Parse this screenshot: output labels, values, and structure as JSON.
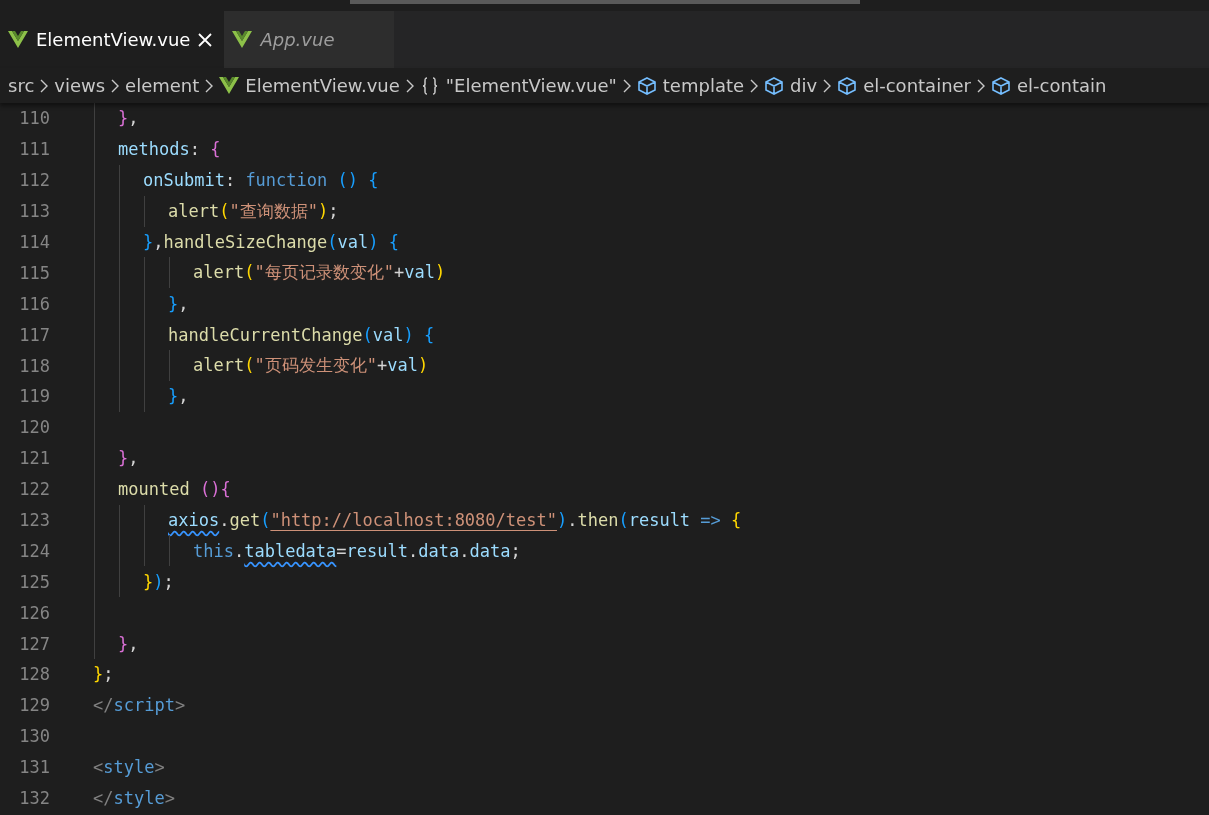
{
  "tabs": [
    {
      "label": "ElementView.vue",
      "selected": true,
      "preview": false
    },
    {
      "label": "App.vue",
      "selected": false,
      "preview": true
    }
  ],
  "breadcrumb": [
    {
      "label": "src",
      "kind": "folder"
    },
    {
      "label": "views",
      "kind": "folder"
    },
    {
      "label": "element",
      "kind": "folder"
    },
    {
      "label": "ElementView.vue",
      "kind": "file"
    },
    {
      "label": "\"ElementView.vue\"",
      "kind": "module"
    },
    {
      "label": "template",
      "kind": "element"
    },
    {
      "label": "div",
      "kind": "element"
    },
    {
      "label": "el-container",
      "kind": "element"
    },
    {
      "label": "el-contain",
      "kind": "element"
    }
  ],
  "lines": [
    {
      "number": "110",
      "tokens": [
        {
          "text": "\t}",
          "kind": "bracket2"
        },
        {
          "text": ",",
          "kind": "plain"
        }
      ]
    },
    {
      "number": "111",
      "tokens": [
        {
          "text": "\tmethods",
          "kind": "variable"
        },
        {
          "text": ": ",
          "kind": "plain"
        },
        {
          "text": "{",
          "kind": "bracket2"
        }
      ]
    },
    {
      "number": "112",
      "tokens": [
        {
          "text": "\t\tonSubmit",
          "kind": "variable"
        },
        {
          "text": ": ",
          "kind": "plain"
        },
        {
          "text": "function ",
          "kind": "keyword"
        },
        {
          "text": "() ",
          "kind": "bracket3"
        },
        {
          "text": "{",
          "kind": "bracket3"
        }
      ]
    },
    {
      "number": "113",
      "tokens": [
        {
          "text": "\t\t\talert",
          "kind": "function"
        },
        {
          "text": "(",
          "kind": "bracket1"
        },
        {
          "text": "\"查询数据\"",
          "kind": "string"
        },
        {
          "text": ")",
          "kind": "bracket1"
        },
        {
          "text": ";",
          "kind": "plain"
        }
      ]
    },
    {
      "number": "114",
      "tokens": [
        {
          "text": "\t\t}",
          "kind": "bracket3"
        },
        {
          "text": ",",
          "kind": "plain"
        },
        {
          "text": "handleSizeChange",
          "kind": "function"
        },
        {
          "text": "(",
          "kind": "bracket3"
        },
        {
          "text": "val",
          "kind": "variable"
        },
        {
          "text": ") ",
          "kind": "bracket3"
        },
        {
          "text": "{",
          "kind": "bracket3"
        }
      ]
    },
    {
      "number": "115",
      "tokens": [
        {
          "text": "\t\t\t\talert",
          "kind": "function"
        },
        {
          "text": "(",
          "kind": "bracket1"
        },
        {
          "text": "\"每页记录数变化\"",
          "kind": "string"
        },
        {
          "text": "+",
          "kind": "plain"
        },
        {
          "text": "val",
          "kind": "variable"
        },
        {
          "text": ")",
          "kind": "bracket1"
        }
      ]
    },
    {
      "number": "116",
      "tokens": [
        {
          "text": "\t\t\t}",
          "kind": "bracket3"
        },
        {
          "text": ",",
          "kind": "plain"
        }
      ]
    },
    {
      "number": "117",
      "tokens": [
        {
          "text": "\t\t\thandleCurrentChange",
          "kind": "function"
        },
        {
          "text": "(",
          "kind": "bracket3"
        },
        {
          "text": "val",
          "kind": "variable"
        },
        {
          "text": ") ",
          "kind": "bracket3"
        },
        {
          "text": "{",
          "kind": "bracket3"
        }
      ]
    },
    {
      "number": "118",
      "tokens": [
        {
          "text": "\t\t\t\talert",
          "kind": "function"
        },
        {
          "text": "(",
          "kind": "bracket1"
        },
        {
          "text": "\"页码发生变化\"",
          "kind": "string"
        },
        {
          "text": "+",
          "kind": "plain"
        },
        {
          "text": "val",
          "kind": "variable"
        },
        {
          "text": ")",
          "kind": "bracket1"
        }
      ]
    },
    {
      "number": "119",
      "tokens": [
        {
          "text": "\t\t\t}",
          "kind": "bracket3"
        },
        {
          "text": ",",
          "kind": "plain"
        }
      ]
    },
    {
      "number": "120"
    },
    {
      "number": "121",
      "tokens": [
        {
          "text": "\t}",
          "kind": "bracket2"
        },
        {
          "text": ",",
          "kind": "plain"
        }
      ]
    },
    {
      "number": "122",
      "tokens": [
        {
          "text": "\tmounted ",
          "kind": "function"
        },
        {
          "text": "()",
          "kind": "bracket2"
        },
        {
          "text": "{",
          "kind": "bracket2"
        }
      ]
    },
    {
      "number": "123",
      "tokens": [
        {
          "text": "\t\t\taxios",
          "kind": "warned"
        },
        {
          "text": ".",
          "kind": "plain"
        },
        {
          "text": "get",
          "kind": "function"
        },
        {
          "text": "(",
          "kind": "bracket3"
        },
        {
          "text": "\"http://localhost:8080/test\"",
          "kind": "link"
        },
        {
          "text": ")",
          "kind": "bracket3"
        },
        {
          "text": ".",
          "kind": "plain"
        },
        {
          "text": "then",
          "kind": "function"
        },
        {
          "text": "(",
          "kind": "bracket3"
        },
        {
          "text": "result ",
          "kind": "variable"
        },
        {
          "text": "=> ",
          "kind": "keyword"
        },
        {
          "text": "{",
          "kind": "bracket1"
        }
      ]
    },
    {
      "number": "124",
      "tokens": [
        {
          "text": "\t\t\t\tthis",
          "kind": "keyword"
        },
        {
          "text": ".",
          "kind": "plain"
        },
        {
          "text": "tabledata",
          "kind": "warned"
        },
        {
          "text": "=",
          "kind": "plain"
        },
        {
          "text": "result",
          "kind": "variable"
        },
        {
          "text": ".",
          "kind": "plain"
        },
        {
          "text": "data",
          "kind": "variable"
        },
        {
          "text": ".",
          "kind": "plain"
        },
        {
          "text": "data",
          "kind": "variable"
        },
        {
          "text": ";",
          "kind": "plain"
        }
      ]
    },
    {
      "number": "125",
      "tokens": [
        {
          "text": "\t\t}",
          "kind": "bracket1"
        },
        {
          "text": ")",
          "kind": "bracket3"
        },
        {
          "text": ";",
          "kind": "plain"
        }
      ]
    },
    {
      "number": "126"
    },
    {
      "number": "127",
      "tokens": [
        {
          "text": "\t}",
          "kind": "bracket2"
        },
        {
          "text": ",",
          "kind": "plain"
        }
      ]
    },
    {
      "number": "128",
      "tokens": [
        {
          "text": "}",
          "kind": "bracket1"
        },
        {
          "text": ";",
          "kind": "plain"
        }
      ]
    },
    {
      "number": "129",
      "tokens": [
        {
          "text": "</",
          "kind": "tagmark"
        },
        {
          "text": "script",
          "kind": "keyword"
        },
        {
          "text": ">",
          "kind": "tagmark"
        }
      ]
    },
    {
      "number": "130"
    },
    {
      "number": "131",
      "tokens": [
        {
          "text": "<",
          "kind": "tagmark"
        },
        {
          "text": "style",
          "kind": "keyword"
        },
        {
          "text": ">",
          "kind": "tagmark"
        }
      ]
    },
    {
      "number": "132",
      "tokens": [
        {
          "text": "</",
          "kind": "tagmark"
        },
        {
          "text": "style",
          "kind": "keyword"
        },
        {
          "text": ">",
          "kind": "tagmark"
        }
      ]
    }
  ]
}
